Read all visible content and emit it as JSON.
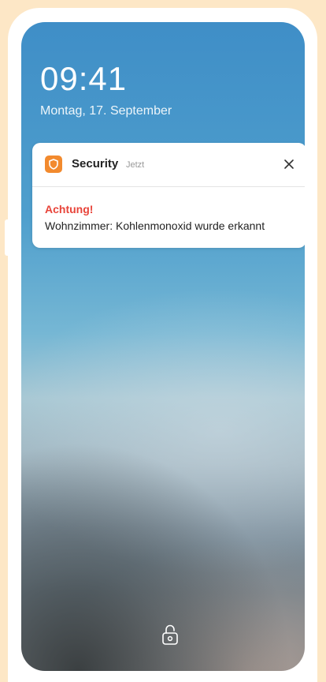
{
  "lockscreen": {
    "time": "09:41",
    "date": "Montag, 17. September"
  },
  "notification": {
    "app_name": "Security",
    "timestamp": "Jetzt",
    "title": "Achtung!",
    "message": "Wohnzimmer: Kohlenmonoxid wurde erkannt",
    "app_icon": "shield-icon",
    "close_icon": "close-icon"
  },
  "footer": {
    "icon": "lock-icon"
  },
  "colors": {
    "background": "#fde7c6",
    "app_icon": "#f28a2e",
    "alert": "#e8443a"
  }
}
